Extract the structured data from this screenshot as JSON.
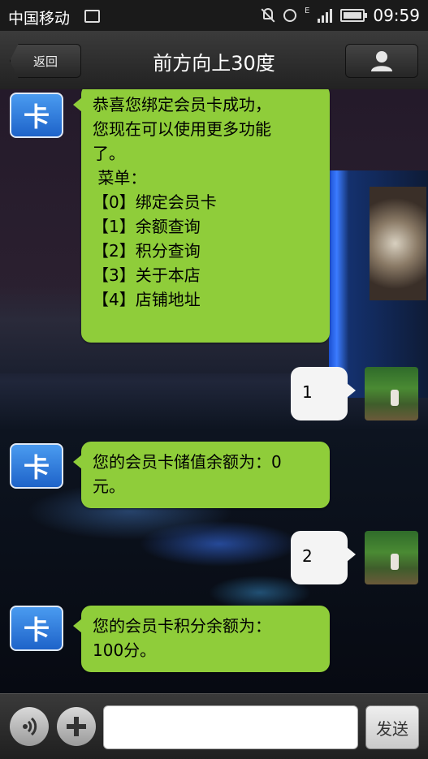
{
  "status_bar": {
    "carrier": "中国移动",
    "network": "E",
    "time": "09:59"
  },
  "header": {
    "back_label": "返回",
    "title": "前方向上30度"
  },
  "avatar_text": "卡",
  "messages": [
    {
      "side": "left",
      "lines": [
        "恭喜您绑定会员卡成功，",
        "您现在可以使用更多功能",
        "了。"
      ],
      "menu_title": " 菜单：",
      "menu": [
        "【0】绑定会员卡",
        "【1】余额查询",
        "【2】积分查询",
        "【3】关于本店",
        "【4】店铺地址"
      ]
    },
    {
      "side": "right",
      "text": "1"
    },
    {
      "side": "left",
      "lines": [
        "您的会员卡储值余额为：0",
        "元。"
      ]
    },
    {
      "side": "right",
      "text": "2"
    },
    {
      "side": "left",
      "lines": [
        "您的会员卡积分余额为：",
        "100分。"
      ]
    }
  ],
  "input": {
    "placeholder": "",
    "send_label": "发送"
  }
}
